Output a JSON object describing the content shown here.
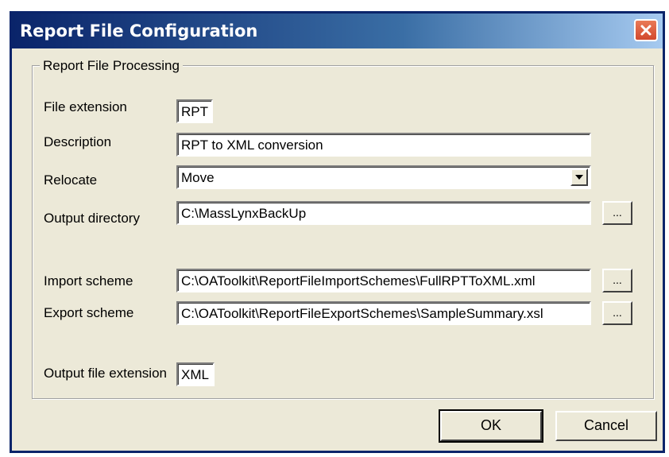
{
  "window": {
    "title": "Report File Configuration",
    "close_icon": "close-icon"
  },
  "group": {
    "title": "Report File Processing"
  },
  "fields": {
    "file_extension": {
      "label": "File extension",
      "value": "RPT"
    },
    "description": {
      "label": "Description",
      "value": "RPT to XML conversion"
    },
    "relocate": {
      "label": "Relocate",
      "value": "Move"
    },
    "output_directory": {
      "label": "Output directory",
      "value": "C:\\MassLynxBackUp",
      "browse": "..."
    },
    "import_scheme": {
      "label": "Import scheme",
      "value": "C:\\OAToolkit\\ReportFileImportSchemes\\FullRPTToXML.xml",
      "browse": "..."
    },
    "export_scheme": {
      "label": "Export scheme",
      "value": "C:\\OAToolkit\\ReportFileExportSchemes\\SampleSummary.xsl",
      "browse": "..."
    },
    "output_file_extension": {
      "label": "Output file extension",
      "value": "XML"
    }
  },
  "buttons": {
    "ok": "OK",
    "cancel": "Cancel"
  },
  "colors": {
    "title_bar": "#0a246a",
    "dialog_bg": "#ece9d8",
    "close_button": "#d2492e"
  }
}
